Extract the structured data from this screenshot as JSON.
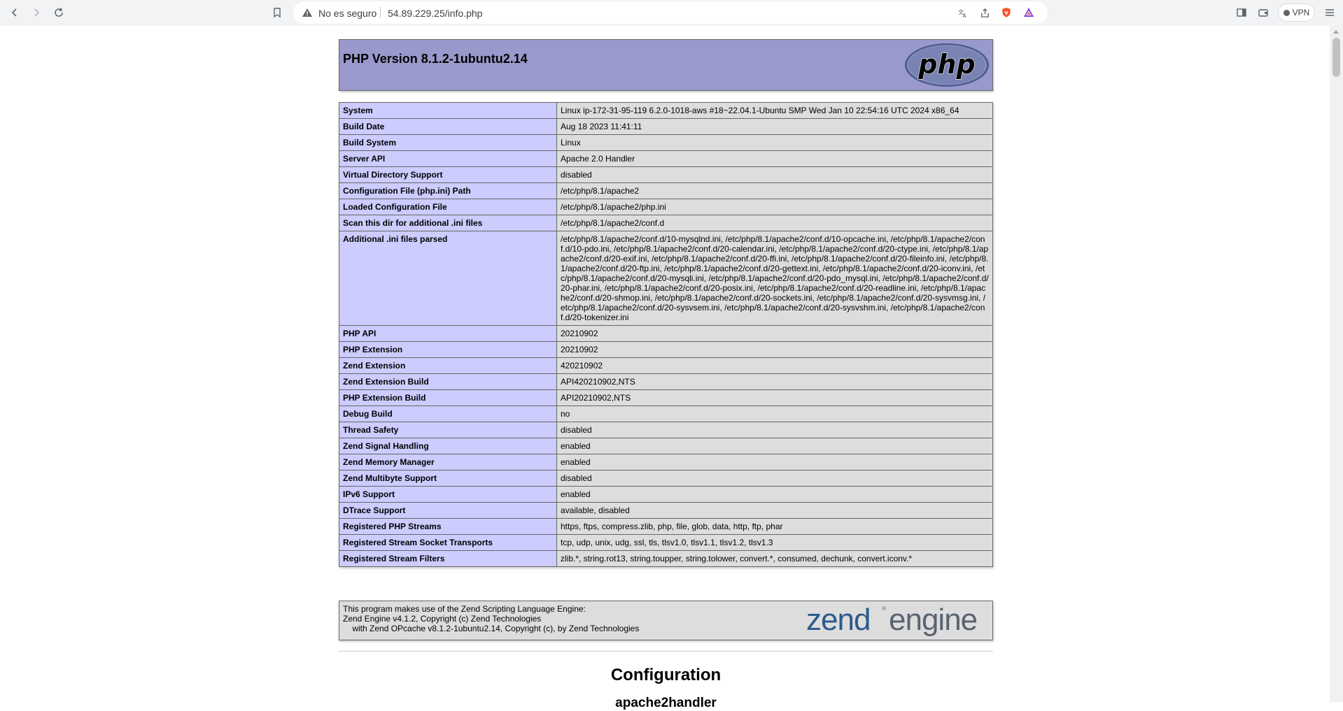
{
  "browser": {
    "security_label": "No es seguro",
    "url": "54.89.229.25/info.php",
    "vpn_label": "VPN"
  },
  "phpinfo": {
    "title": "PHP Version 8.1.2-1ubuntu2.14",
    "logo_text": "php",
    "rows": [
      {
        "key": "System",
        "value": "Linux ip-172-31-95-119 6.2.0-1018-aws #18~22.04.1-Ubuntu SMP Wed Jan 10 22:54:16 UTC 2024 x86_64"
      },
      {
        "key": "Build Date",
        "value": "Aug 18 2023 11:41:11"
      },
      {
        "key": "Build System",
        "value": "Linux"
      },
      {
        "key": "Server API",
        "value": "Apache 2.0 Handler"
      },
      {
        "key": "Virtual Directory Support",
        "value": "disabled"
      },
      {
        "key": "Configuration File (php.ini) Path",
        "value": "/etc/php/8.1/apache2"
      },
      {
        "key": "Loaded Configuration File",
        "value": "/etc/php/8.1/apache2/php.ini"
      },
      {
        "key": "Scan this dir for additional .ini files",
        "value": "/etc/php/8.1/apache2/conf.d"
      },
      {
        "key": "Additional .ini files parsed",
        "value": "/etc/php/8.1/apache2/conf.d/10-mysqlnd.ini, /etc/php/8.1/apache2/conf.d/10-opcache.ini, /etc/php/8.1/apache2/conf.d/10-pdo.ini, /etc/php/8.1/apache2/conf.d/20-calendar.ini, /etc/php/8.1/apache2/conf.d/20-ctype.ini, /etc/php/8.1/apache2/conf.d/20-exif.ini, /etc/php/8.1/apache2/conf.d/20-ffi.ini, /etc/php/8.1/apache2/conf.d/20-fileinfo.ini, /etc/php/8.1/apache2/conf.d/20-ftp.ini, /etc/php/8.1/apache2/conf.d/20-gettext.ini, /etc/php/8.1/apache2/conf.d/20-iconv.ini, /etc/php/8.1/apache2/conf.d/20-mysqli.ini, /etc/php/8.1/apache2/conf.d/20-pdo_mysql.ini, /etc/php/8.1/apache2/conf.d/20-phar.ini, /etc/php/8.1/apache2/conf.d/20-posix.ini, /etc/php/8.1/apache2/conf.d/20-readline.ini, /etc/php/8.1/apache2/conf.d/20-shmop.ini, /etc/php/8.1/apache2/conf.d/20-sockets.ini, /etc/php/8.1/apache2/conf.d/20-sysvmsg.ini, /etc/php/8.1/apache2/conf.d/20-sysvsem.ini, /etc/php/8.1/apache2/conf.d/20-sysvshm.ini, /etc/php/8.1/apache2/conf.d/20-tokenizer.ini"
      },
      {
        "key": "PHP API",
        "value": "20210902"
      },
      {
        "key": "PHP Extension",
        "value": "20210902"
      },
      {
        "key": "Zend Extension",
        "value": "420210902"
      },
      {
        "key": "Zend Extension Build",
        "value": "API420210902,NTS"
      },
      {
        "key": "PHP Extension Build",
        "value": "API20210902,NTS"
      },
      {
        "key": "Debug Build",
        "value": "no"
      },
      {
        "key": "Thread Safety",
        "value": "disabled"
      },
      {
        "key": "Zend Signal Handling",
        "value": "enabled"
      },
      {
        "key": "Zend Memory Manager",
        "value": "enabled"
      },
      {
        "key": "Zend Multibyte Support",
        "value": "disabled"
      },
      {
        "key": "IPv6 Support",
        "value": "enabled"
      },
      {
        "key": "DTrace Support",
        "value": "available, disabled"
      },
      {
        "key": "Registered PHP Streams",
        "value": "https, ftps, compress.zlib, php, file, glob, data, http, ftp, phar"
      },
      {
        "key": "Registered Stream Socket Transports",
        "value": "tcp, udp, unix, udg, ssl, tls, tlsv1.0, tlsv1.1, tlsv1.2, tlsv1.3"
      },
      {
        "key": "Registered Stream Filters",
        "value": "zlib.*, string.rot13, string.toupper, string.tolower, convert.*, consumed, dechunk, convert.iconv.*"
      }
    ],
    "zend": {
      "line1": "This program makes use of the Zend Scripting Language Engine:",
      "line2": "Zend Engine v4.1.2, Copyright (c) Zend Technologies",
      "line3": "    with Zend OPcache v8.1.2-1ubuntu2.14, Copyright (c), by Zend Technologies",
      "logo_zend": "zend",
      "logo_engine": "engine"
    },
    "configuration_heading": "Configuration",
    "module_heading": "apache2handler"
  }
}
